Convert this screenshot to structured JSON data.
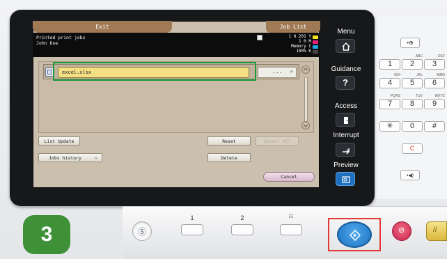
{
  "screen": {
    "exit_label": "Exit",
    "job_list_label": "Job List",
    "header_line1": "Printed print jobs",
    "header_line2": "John Doe",
    "toner": [
      {
        "text": "1 0 201 Y",
        "color": "#f7e11a"
      },
      {
        "text": "1 0 M",
        "color": "#e4237c"
      },
      {
        "text": "Memory C",
        "color": "#1fa3e2"
      },
      {
        "text": "100% K",
        "color": "#444444"
      }
    ],
    "file_name": "excel.xlsx",
    "detail_label": "...",
    "list_update_label": "List Update",
    "reset_label": "Reset",
    "select_all_label": "Select All",
    "jobs_history_label": "Jobs history",
    "delete_label": "Delete",
    "cancel_label": "Cancel"
  },
  "side_panel": {
    "menu_label": "Menu",
    "guidance_label": "Guidance",
    "access_label": "Access",
    "interrupt_label": "Interrupt",
    "preview_label": "Preview"
  },
  "keypad": {
    "keys": [
      {
        "main": "1",
        "sub": ""
      },
      {
        "main": "2",
        "sub": "ABC"
      },
      {
        "main": "3",
        "sub": "DEF"
      },
      {
        "main": "4",
        "sub": "GHI"
      },
      {
        "main": "5",
        "sub": "JKL"
      },
      {
        "main": "6",
        "sub": "MNO"
      },
      {
        "main": "7",
        "sub": "PQRS"
      },
      {
        "main": "8",
        "sub": "TUV"
      },
      {
        "main": "9",
        "sub": "WXYZ"
      },
      {
        "main": "✳",
        "sub": ""
      },
      {
        "main": "0",
        "sub": ""
      },
      {
        "main": "#",
        "sub": ""
      }
    ],
    "clear_label": "C"
  },
  "program_keys": {
    "one": "1",
    "two": "2",
    "three": "⁝⁝⁝"
  },
  "step": "3",
  "colors": {
    "accent_green": "#1e9a3a",
    "step_green": "#3f9138",
    "start_blue": "#2e8fd8",
    "highlight_red": "#e53935"
  }
}
